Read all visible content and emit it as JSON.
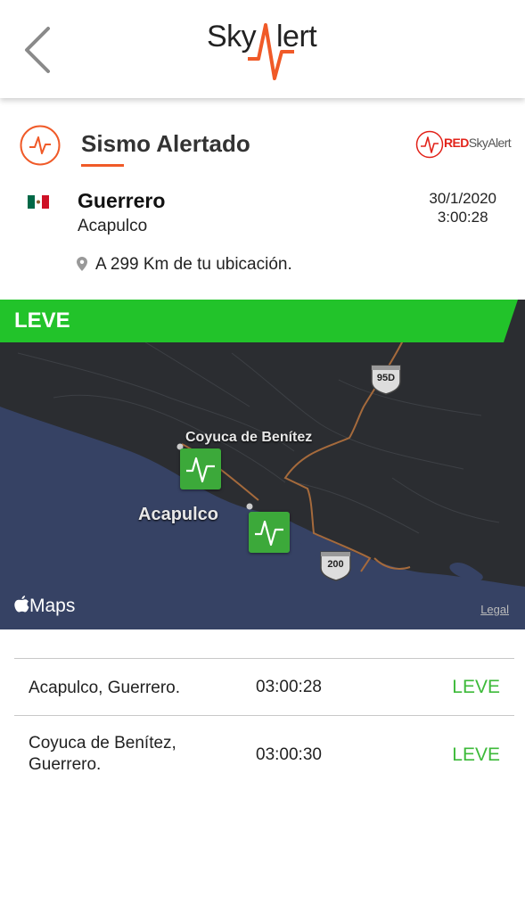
{
  "header": {
    "logo_text_left": "Sky",
    "logo_text_right": "lert",
    "brand_color": "#f05a28"
  },
  "alert": {
    "title": "Sismo Alertado",
    "network_logo_text": "RED",
    "network_logo_text2": "SkyAlert",
    "region": "Guerrero",
    "city": "Acapulco",
    "date": "30/1/2020",
    "time": "3:00:28",
    "distance": "A 299 Km de tu ubicación."
  },
  "map": {
    "level": "LEVE",
    "level_color": "#22c32a",
    "labels": {
      "coyuca": "Coyuca de Benítez",
      "acapulco": "Acapulco",
      "highway_95d": "95D",
      "highway_200": "200"
    },
    "maps_brand": "Maps",
    "legal": "Legal"
  },
  "events": [
    {
      "place": "Acapulco, Guerrero.",
      "time": "03:00:28",
      "level": "LEVE"
    },
    {
      "place_line1": "Coyuca de Benítez,",
      "place_line2": "Guerrero.",
      "time": "03:00:30",
      "level": "LEVE"
    }
  ]
}
